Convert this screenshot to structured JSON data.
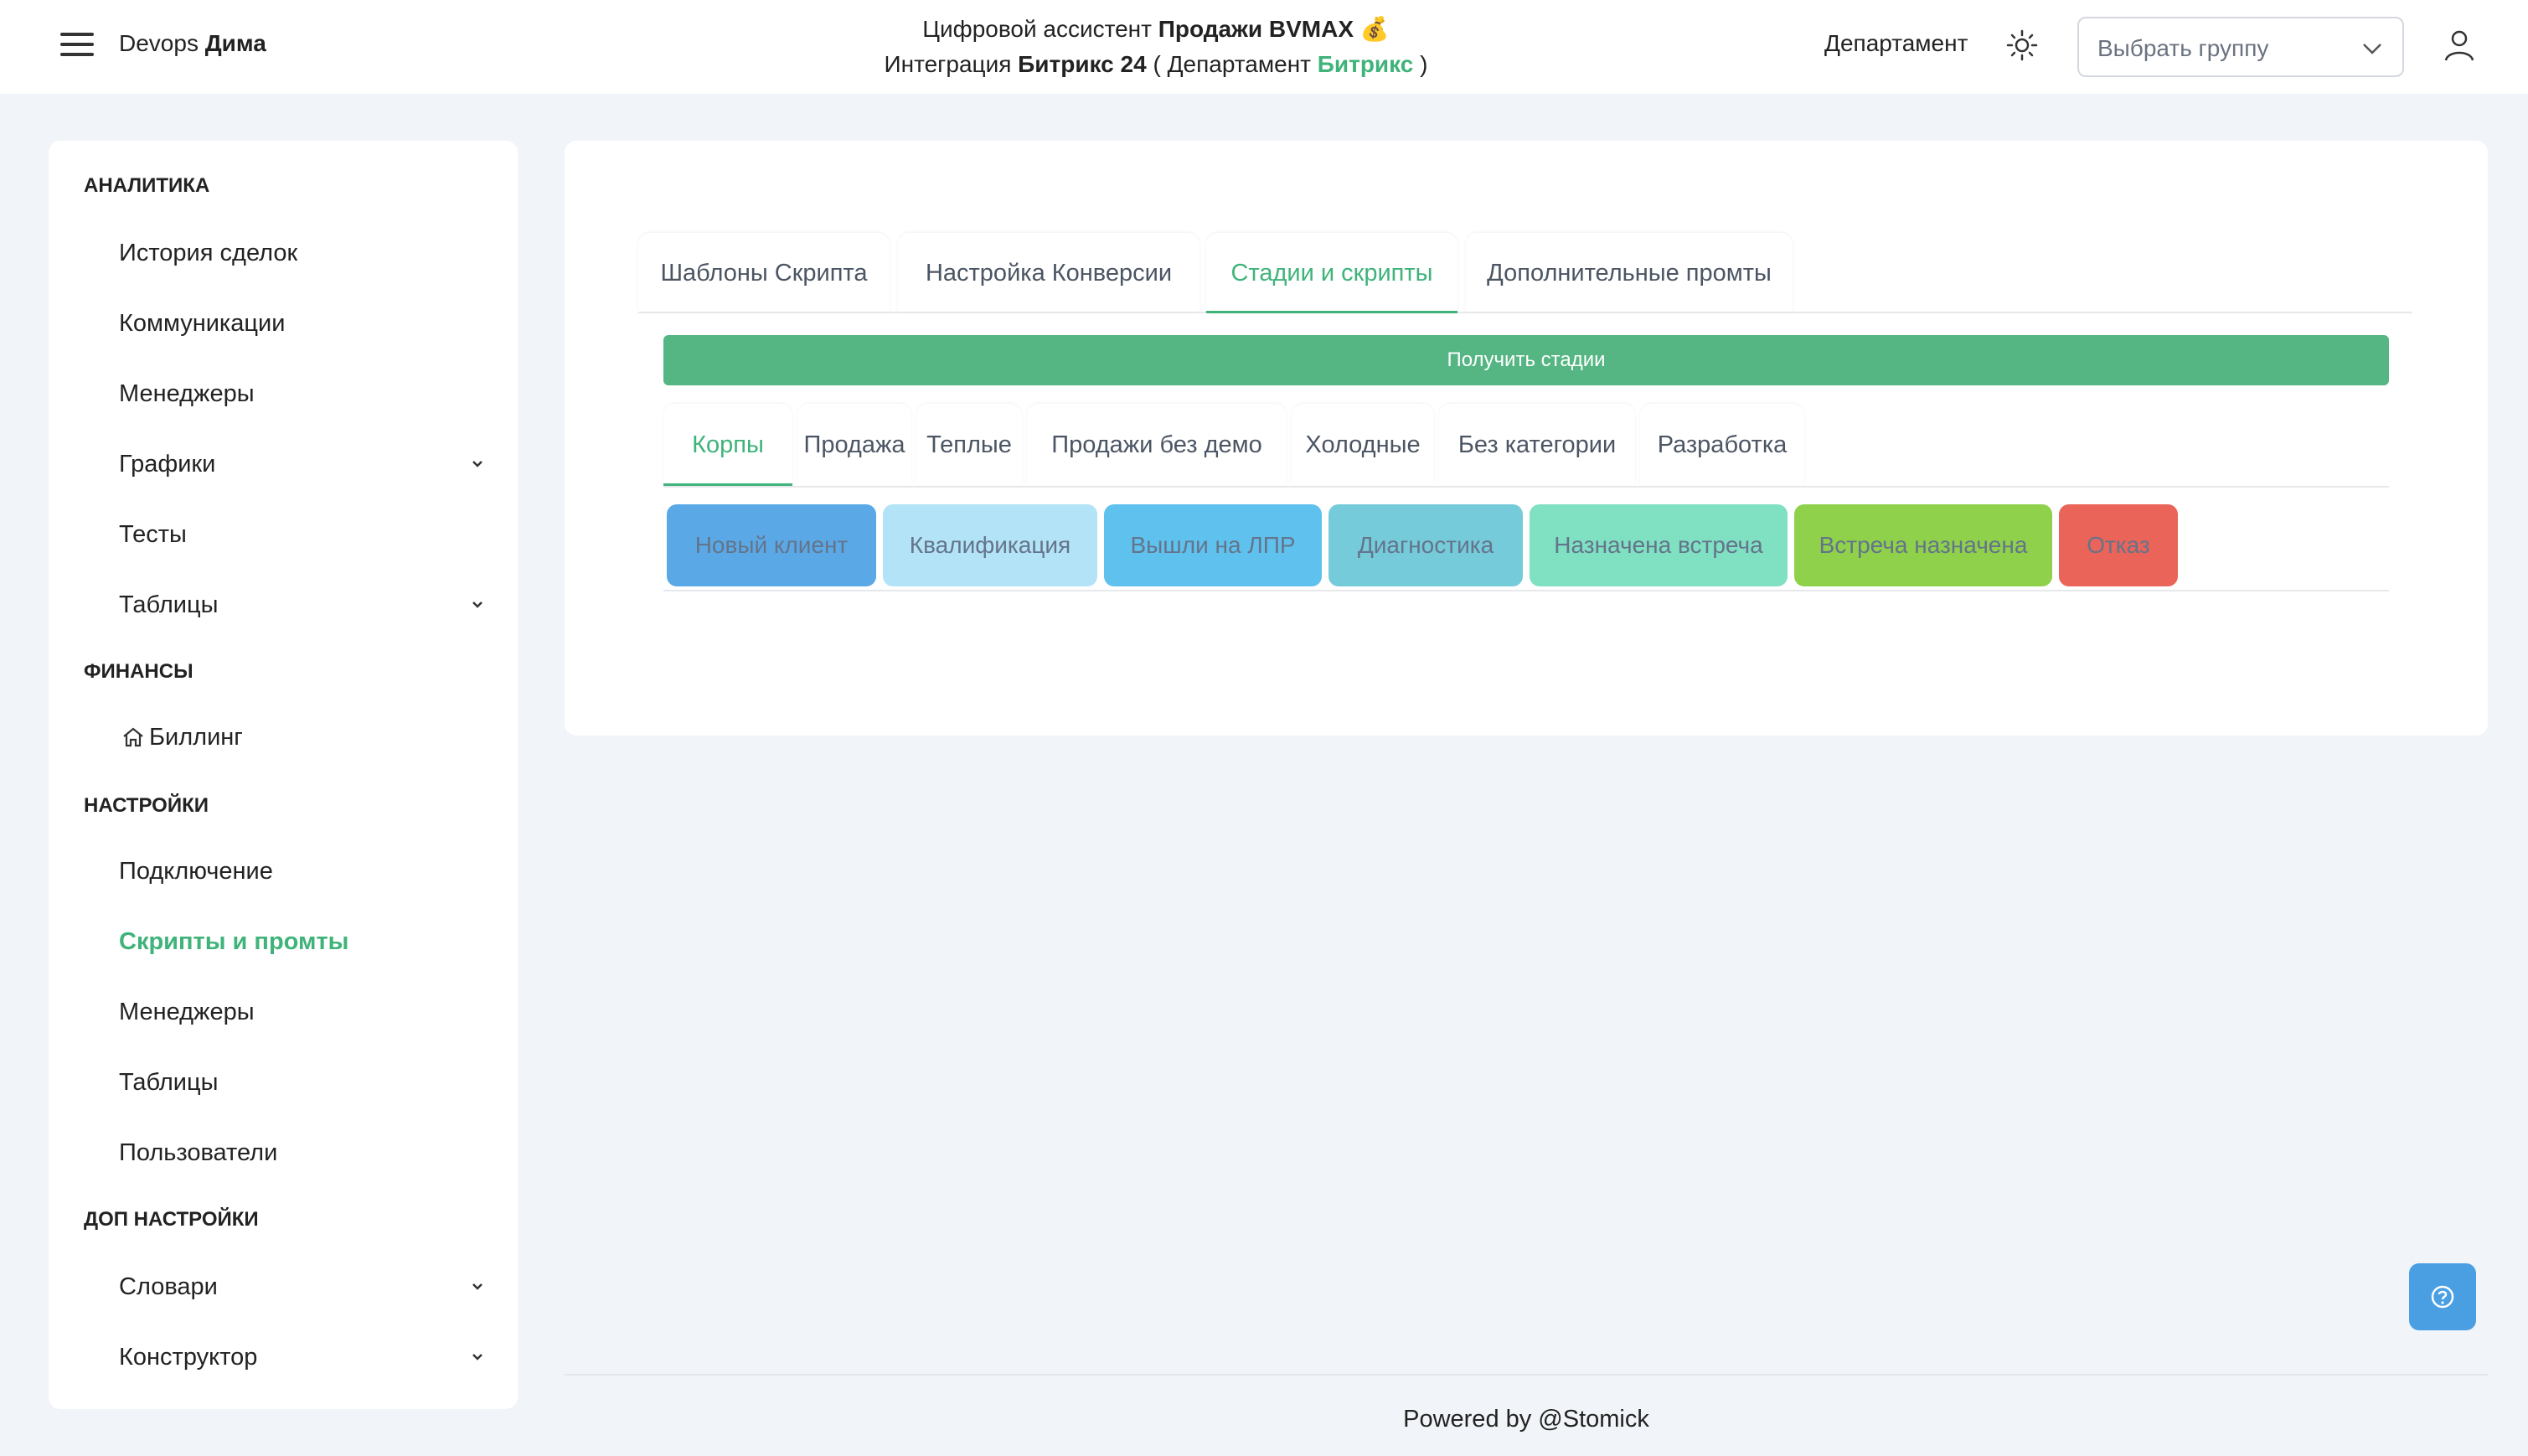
{
  "header": {
    "user_first": "Devops",
    "user_last": "Дима",
    "line1_prefix": "Цифровой ассистент ",
    "line1_bold": "Продажи BVMAX",
    "line1_emoji": "💰",
    "line2_prefix": "Интеграция ",
    "line2_bold": "Битрикс 24",
    "line2_mid": " ( Департамент ",
    "line2_green": "Битрикс",
    "line2_end": " )",
    "department_label": "Департамент",
    "group_placeholder": "Выбрать группу"
  },
  "sidebar": {
    "sections": [
      {
        "title": "АНАЛИТИКА"
      },
      {
        "title": "ФИНАНСЫ"
      },
      {
        "title": "НАСТРОЙКИ"
      },
      {
        "title": "ДОП НАСТРОЙКИ"
      }
    ],
    "items": [
      {
        "label": "История сделок"
      },
      {
        "label": "Коммуникации"
      },
      {
        "label": "Менеджеры"
      },
      {
        "label": "Графики"
      },
      {
        "label": "Тесты"
      },
      {
        "label": "Таблицы"
      },
      {
        "label": "Биллинг"
      },
      {
        "label": "Подключение"
      },
      {
        "label": "Скрипты и промты"
      },
      {
        "label": "Менеджеры"
      },
      {
        "label": "Таблицы"
      },
      {
        "label": "Пользователи"
      },
      {
        "label": "Словари"
      },
      {
        "label": "Конструктор"
      }
    ]
  },
  "main": {
    "tabs": [
      {
        "label": "Шаблоны Скрипта"
      },
      {
        "label": "Настройка Конверсии"
      },
      {
        "label": "Стадии и скрипты"
      },
      {
        "label": "Дополнительные промты"
      }
    ],
    "get_stages_label": "Получить стадии",
    "category_tabs": [
      {
        "label": "Корпы"
      },
      {
        "label": "Продажа"
      },
      {
        "label": "Теплые"
      },
      {
        "label": "Продажи без демо"
      },
      {
        "label": "Холодные"
      },
      {
        "label": "Без категории"
      },
      {
        "label": "Разработка"
      }
    ],
    "stages": [
      {
        "label": "Новый клиент",
        "color": "#5aa9e6"
      },
      {
        "label": "Квалификация",
        "color": "#b3e3f7"
      },
      {
        "label": "Вышли на ЛПР",
        "color": "#5fc2ee"
      },
      {
        "label": "Диагностика",
        "color": "#75cbd9"
      },
      {
        "label": "Назначена встреча",
        "color": "#7fe0c2"
      },
      {
        "label": "Встреча назначена",
        "color": "#8fd14a"
      },
      {
        "label": "Отказ",
        "color": "#ea6459"
      }
    ]
  },
  "footer": {
    "text": "Powered by @Stomick"
  },
  "colors": {
    "accent": "#3fb37a",
    "help_button": "#4a9fe3"
  }
}
